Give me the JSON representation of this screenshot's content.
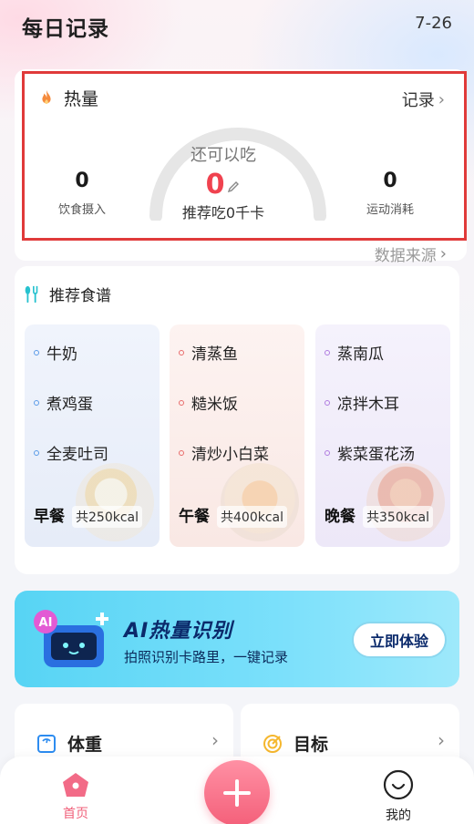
{
  "header": {
    "title": "每日记录",
    "date": "7-26"
  },
  "calorie": {
    "title": "热量",
    "record_label": "记录",
    "remaining_label": "还可以吃",
    "remaining_value": "0",
    "suggest_text": "推荐吃0千卡",
    "intake_value": "0",
    "intake_label": "饮食摄入",
    "burn_value": "0",
    "burn_label": "运动消耗",
    "source_label": "数据来源",
    "highlight_color": "#e03a3a",
    "accent_color": "#f0424f"
  },
  "recipes": {
    "title": "推荐食谱",
    "meals": [
      {
        "name": "早餐",
        "kcal": "共250kcal",
        "items": [
          "牛奶",
          "煮鸡蛋",
          "全麦吐司"
        ]
      },
      {
        "name": "午餐",
        "kcal": "共400kcal",
        "items": [
          "清蒸鱼",
          "糙米饭",
          "清炒小白菜"
        ]
      },
      {
        "name": "晚餐",
        "kcal": "共350kcal",
        "items": [
          "蒸南瓜",
          "凉拌木耳",
          "紫菜蛋花汤"
        ]
      }
    ]
  },
  "ai_banner": {
    "badge": "AI",
    "title": "AI热量识别",
    "subtitle": "拍照识别卡路里，一键记录",
    "button": "立即体验"
  },
  "cards": {
    "weight": "体重",
    "goal": "目标"
  },
  "nav": {
    "home": "首页",
    "mine": "我的"
  },
  "icons": [
    "flame-icon",
    "chevron-right-icon",
    "edit-icon",
    "utensils-icon",
    "robot-icon",
    "scale-icon",
    "target-icon",
    "home-icon",
    "add-icon",
    "profile-icon"
  ]
}
